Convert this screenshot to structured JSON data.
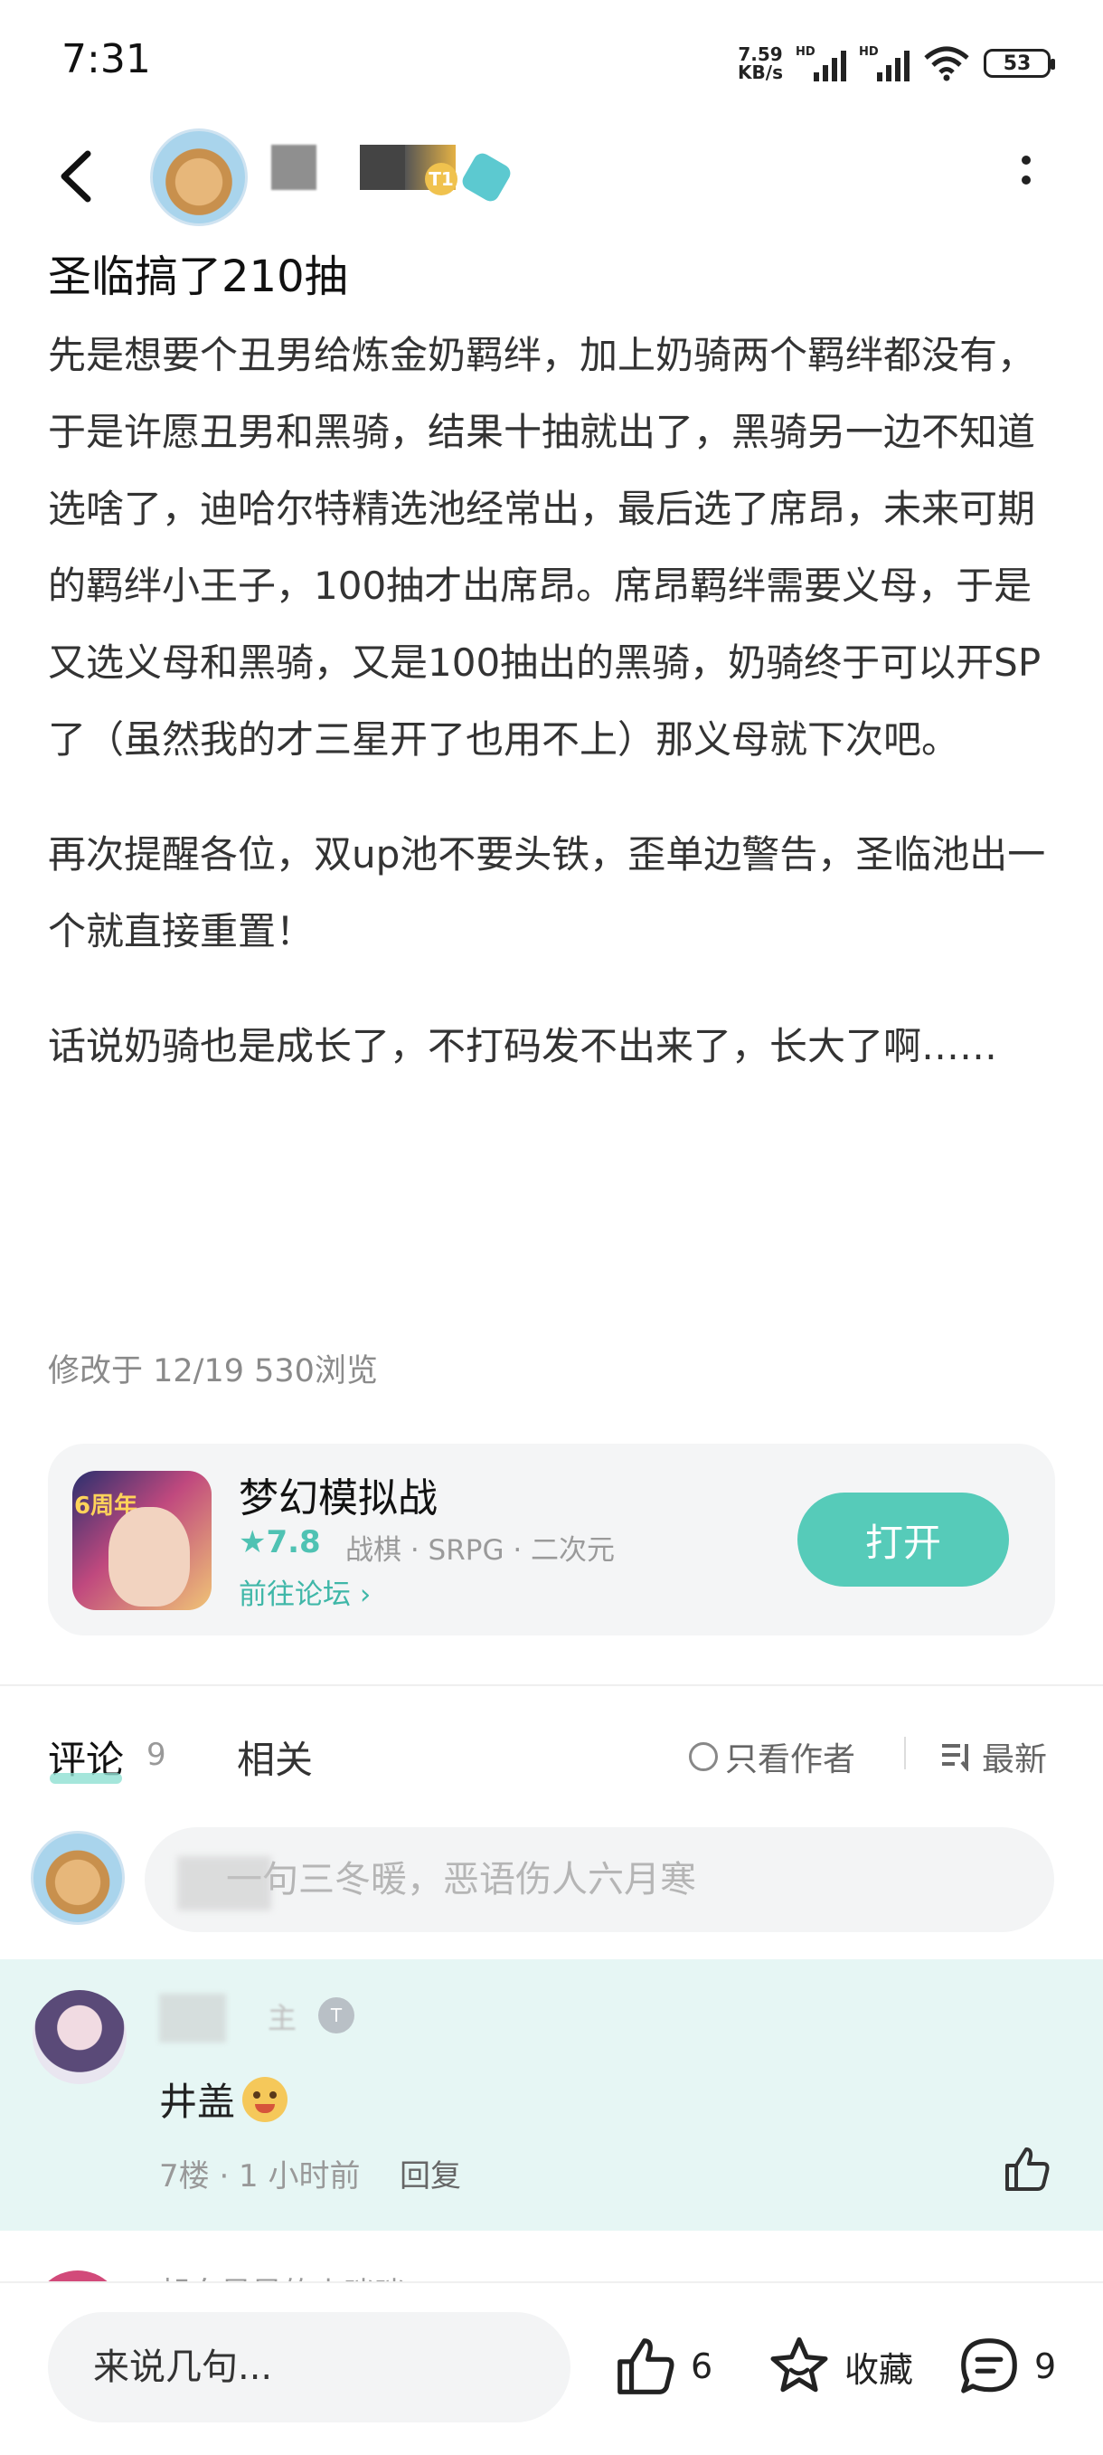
{
  "status_bar": {
    "time": "7:31",
    "net_speed_value": "7.59",
    "net_speed_unit": "KB/s",
    "signal_1_label": "HD",
    "signal_2_label": "HD",
    "battery": "53"
  },
  "header": {
    "level_badge": "T1"
  },
  "post": {
    "title": "圣临搞了210抽",
    "paragraphs": [
      "先是想要个丑男给炼金奶羁绊，加上奶骑两个羁绊都没有，于是许愿丑男和黑骑，结果十抽就出了，黑骑另一边不知道选啥了，迪哈尔特精选池经常出，最后选了席昂，未来可期的羁绊小王子，100抽才出席昂。席昂羁绊需要义母，于是又选义母和黑骑，又是100抽出的黑骑，奶骑终于可以开SP了（虽然我的才三星开了也用不上）那义母就下次吧。",
      "再次提醒各位，双up池不要头铁，歪单边警告，圣临池出一个就直接重置！",
      "话说奶骑也是成长了，不打码发不出来了，长大了啊……"
    ],
    "meta": "修改于 12/19  530浏览"
  },
  "game_card": {
    "icon_tag": "6周年",
    "name": "梦幻模拟战",
    "rating": "★7.8",
    "tags": "战棋 · SRPG · 二次元",
    "forum_link": "前往论坛 ›",
    "open_button": "打开",
    "accent_color": "#56cbb9"
  },
  "comments_section": {
    "tab_comments": "评论",
    "tab_comments_count": "9",
    "tab_related": "相关",
    "only_author": "只看作者",
    "sort_label": "最新",
    "input_placeholder": "一句三冬暖，恶语伤人六月寒"
  },
  "comment": {
    "user_visible": "主",
    "badge": "T",
    "text": "井盖",
    "meta": "7楼 · 1 小时前",
    "reply": "回复"
  },
  "next_comment": {
    "user_partial": "朝白星星的小咪咪"
  },
  "bottom_bar": {
    "input_placeholder": "来说几句...",
    "like_count": "6",
    "favorite_label": "收藏",
    "comment_count": "9"
  }
}
